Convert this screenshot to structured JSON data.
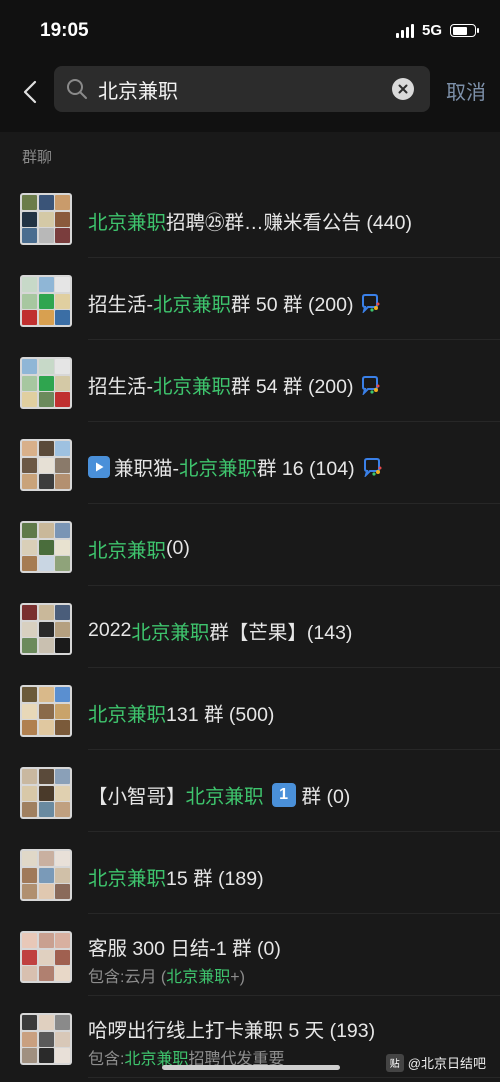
{
  "status": {
    "time": "19:05",
    "network": "5G"
  },
  "search": {
    "query": "北京兼职",
    "cancel_label": "取消"
  },
  "section_label": "群聊",
  "results": [
    {
      "pre": "",
      "hl": "北京兼职",
      "post": "招聘㉕群…赚米看公告 (440)",
      "avatar_colors": [
        "#6b7c4a",
        "#3a5478",
        "#c99b6b",
        "#223344",
        "#d4c9a6",
        "#8a5a3c",
        "#4a6d8f",
        "#b8b8b8",
        "#7a3d3d"
      ]
    },
    {
      "pre": "招生活-",
      "hl": "北京兼职",
      "post": "群 50 群 (200)",
      "avatar_colors": [
        "#c7d9c8",
        "#8fb6d6",
        "#e5e5e5",
        "#a7c7a0",
        "#2fa54f",
        "#e0cfa0",
        "#c03030",
        "#d8a050",
        "#3b6ea5"
      ]
    },
    {
      "pre": "招生活-",
      "hl": "北京兼职",
      "post": "群 54 群 (200)",
      "avatar_colors": [
        "#8fb6d6",
        "#c7d9c8",
        "#e5e5e5",
        "#a7c7a0",
        "#2fa54f",
        "#d4c9a6",
        "#e0cfa0",
        "#6b8a5c",
        "#c03030"
      ]
    },
    {
      "pre": "",
      "hl": "北京兼职",
      "post": "群 16 (104)",
      "lead": "兼职猫-",
      "avatar_colors": [
        "#d8b08a",
        "#5a4a3a",
        "#9ec1e0",
        "#6b5845",
        "#e6e0d5",
        "#8a7a6a",
        "#c9a37a",
        "#3d3d3d",
        "#b39070"
      ]
    },
    {
      "pre": "",
      "hl": "北京兼职",
      "post": " (0)",
      "avatar_colors": [
        "#5f7a4a",
        "#c9b89a",
        "#7a95b5",
        "#d9cfb8",
        "#4a6d3c",
        "#e8e2d0",
        "#a67c52",
        "#c9d6e3",
        "#8fa37a"
      ]
    },
    {
      "pre": "2022 ",
      "hl": "北京兼职",
      "post": "群【芒果】(143)",
      "avatar_colors": [
        "#7a3030",
        "#c9b89a",
        "#4a5d7a",
        "#d8d0c0",
        "#2a2a2a",
        "#b5a080",
        "#6b8a5c",
        "#c9c0b0",
        "#1a1a1a"
      ]
    },
    {
      "pre": "",
      "hl": "北京兼职",
      "post": " 131 群 (500)",
      "avatar_colors": [
        "#6b5a3a",
        "#d9b98a",
        "#5a8fd0",
        "#e8d8b8",
        "#8a6a4a",
        "#c9a36a",
        "#b08050",
        "#e0c8a0",
        "#7a5a3a"
      ]
    },
    {
      "pre": "【小智哥】",
      "hl": "北京兼职",
      "post": "群 (0)",
      "one": "1",
      "avatar_colors": [
        "#c9b8a0",
        "#5a4a3a",
        "#8aa0b8",
        "#d8c8a8",
        "#4a3a2a",
        "#e0d0b0",
        "#a08060",
        "#6a8aa0",
        "#c0a080"
      ]
    },
    {
      "pre": "",
      "hl": "北京兼职",
      "post": " 15 群 (189)",
      "avatar_colors": [
        "#e0d8c8",
        "#c9b0a0",
        "#e8e0d8",
        "#a07a5a",
        "#7a9ab8",
        "#d0c0a8",
        "#b09070",
        "#e0c8b0",
        "#8a6a5a"
      ]
    },
    {
      "pre": "客服 300 日结-1 群 (0)",
      "hl": "",
      "post": "",
      "sub_pre": "包含:云月 (",
      "sub_hl": "北京兼职",
      "sub_post": "+)",
      "avatar_colors": [
        "#e8c8b8",
        "#c9a090",
        "#d8b0a0",
        "#c04040",
        "#e0d0c0",
        "#a06050",
        "#d8c0b0",
        "#b08070",
        "#e8d8c8"
      ]
    },
    {
      "pre": "哈啰出行线上打卡兼职 5 天 (193)",
      "hl": "",
      "post": "",
      "sub_pre": "包含:",
      "sub_hl": "北京兼职",
      "sub_post": "招聘代发重要",
      "avatar_colors": [
        "#3a3a3a",
        "#e0d0c0",
        "#8a8a8a",
        "#c9a080",
        "#5a5a5a",
        "#d8c8b8",
        "#a09080",
        "#2a2a2a",
        "#e8e0d8"
      ]
    }
  ],
  "watermark": {
    "text": "@北京日结吧",
    "logo": "贴"
  }
}
